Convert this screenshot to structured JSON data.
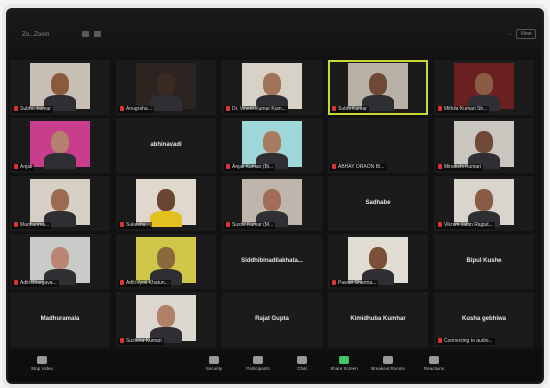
{
  "titlebar": {
    "title": "Zo...Zoom",
    "right_text": "...",
    "view_label": "View"
  },
  "tiles": [
    {
      "label": "Subhi...kumar",
      "kind": "video",
      "skin": "#8a5a3c",
      "bg": "#c9c0b5"
    },
    {
      "label": "Anugraha...",
      "kind": "video",
      "skin": "#3a2a22",
      "bg": "#2b2420"
    },
    {
      "label": "Dr. Vineet Kumar Kum...",
      "kind": "video",
      "skin": "#a0735a",
      "bg": "#d8d2c6"
    },
    {
      "label": "Subhi Kumar",
      "kind": "video",
      "skin": "#6e4a36",
      "bg": "#b9b1a6",
      "active": true
    },
    {
      "label": "Mithila Kumari Sh...",
      "kind": "video",
      "skin": "#8a5c44",
      "bg": "#6a2020"
    },
    {
      "label": "Anjali",
      "kind": "video",
      "skin": "#b48070",
      "bg": "#c83e8c"
    },
    {
      "label": "",
      "kind": "name",
      "center": "abhinavadi"
    },
    {
      "label": "Anjali Kumari (Bi...",
      "kind": "video",
      "skin": "#a87a62",
      "bg": "#9fd6d8"
    },
    {
      "label": "ABHAY ORAON BI...",
      "kind": "empty"
    },
    {
      "label": "Minakshi Kumari",
      "kind": "video",
      "skin": "#6e4a36",
      "bg": "#c9c5bf"
    },
    {
      "label": "Madhurima...",
      "kind": "video",
      "skin": "#9c6a52",
      "bg": "#d6cfc6"
    },
    {
      "label": "Sukesha...",
      "kind": "video",
      "skin": "#6a4632",
      "bg": "#e0d8cc",
      "shirt": "#e2c021"
    },
    {
      "label": "Sushil Kumar (M...",
      "kind": "video",
      "skin": "#a06e58",
      "bg": "#bfb5ab"
    },
    {
      "label": "",
      "kind": "name",
      "center": "Sadhabe"
    },
    {
      "label": "Vikram Jattin Rajput...",
      "kind": "video",
      "skin": "#8a5a44",
      "bg": "#d9d4cc"
    },
    {
      "label": "Aditi Bhargava...",
      "kind": "video",
      "skin": "#b88672",
      "bg": "#c9cbc8"
    },
    {
      "label": "Aditi Jyoti Khatun...",
      "kind": "video",
      "skin": "#8a6a3c",
      "bg": "#d0c64a"
    },
    {
      "label": "",
      "kind": "name",
      "center": "Siddhibinadilakhata..."
    },
    {
      "label": "Pawan Sharma...",
      "kind": "video",
      "skin": "#7a5038",
      "bg": "#e2ddd3"
    },
    {
      "label": "",
      "kind": "name",
      "center": "Bipul Kushe"
    },
    {
      "label": "",
      "kind": "name",
      "center": "Madhuramala"
    },
    {
      "label": "Sushma Kumari",
      "kind": "video",
      "skin": "#b08068",
      "bg": "#ddd8cf"
    },
    {
      "label": "",
      "kind": "name",
      "center": "Rajat Gupta"
    },
    {
      "label": "",
      "kind": "name",
      "center": "Kimidhuba Kumhar"
    },
    {
      "label": "Connecting to audio...",
      "kind": "name",
      "center": "Kusha gebhiwa"
    }
  ],
  "toolbar": {
    "items": [
      {
        "label": "Stop Video",
        "kind": "normal"
      },
      {
        "label": "Security",
        "kind": "normal"
      },
      {
        "label": "Participants",
        "kind": "normal"
      },
      {
        "label": "Chat",
        "kind": "normal"
      },
      {
        "label": "Share Screen",
        "kind": "green"
      },
      {
        "label": "Breakout Rooms",
        "kind": "normal"
      },
      {
        "label": "Reactions",
        "kind": "normal"
      }
    ]
  }
}
